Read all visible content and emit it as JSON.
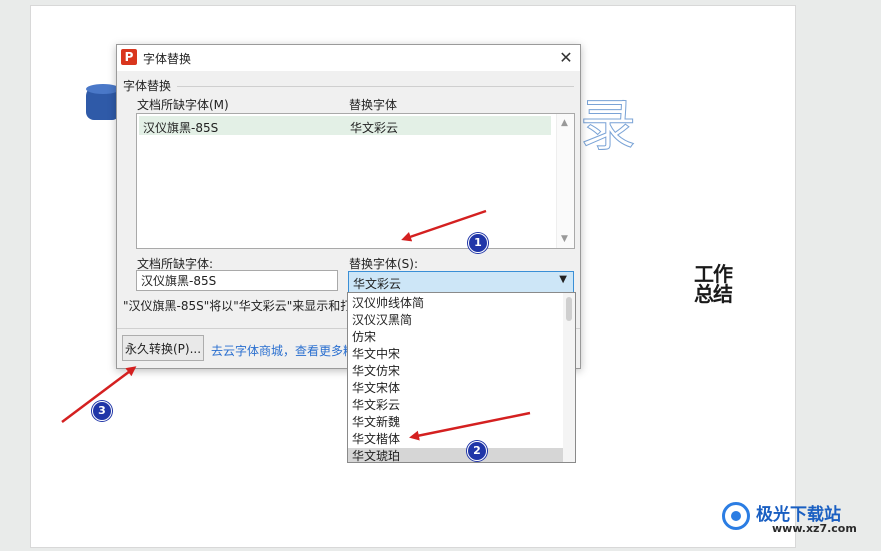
{
  "slide": {
    "heading_glyph": "录",
    "work_summary_line1": "工作",
    "work_summary_line2": "总结"
  },
  "dialog": {
    "app_icon_letter": "P",
    "title": "字体替换",
    "close_symbol": "✕",
    "group_label": "字体替换",
    "column_missing": "文档所缺字体(M)",
    "column_replace": "替换字体",
    "rows": [
      {
        "missing": "汉仪旗黑-85S",
        "replace": "华文彩云"
      }
    ],
    "missing_label": "文档所缺字体:",
    "missing_value": "汉仪旗黑-85S",
    "replace_label": "替换字体(S):",
    "replace_value": "华文彩云",
    "note": "\"汉仪旗黑-85S\"将以\"华文彩云\"来显示和打",
    "permanent_button": "永久转换(P)...",
    "store_link": "去云字体商城，查看更多精"
  },
  "dropdown": {
    "options": [
      "汉仪帅线体简",
      "汉仪汉黑简",
      "仿宋",
      "华文中宋",
      "华文仿宋",
      "华文宋体",
      "华文彩云",
      "华文新魏",
      "华文楷体",
      "华文琥珀"
    ],
    "hovered": "华文琥珀"
  },
  "annotations": {
    "badge1": "1",
    "badge2": "2",
    "badge3": "3",
    "arrow_color": "#d42020"
  },
  "watermark": {
    "title": "极光下载站",
    "url": "www.xz7.com"
  },
  "colors": {
    "accent": "#3a8fd6",
    "badge": "#2036a8",
    "link": "#2a6fcf"
  }
}
